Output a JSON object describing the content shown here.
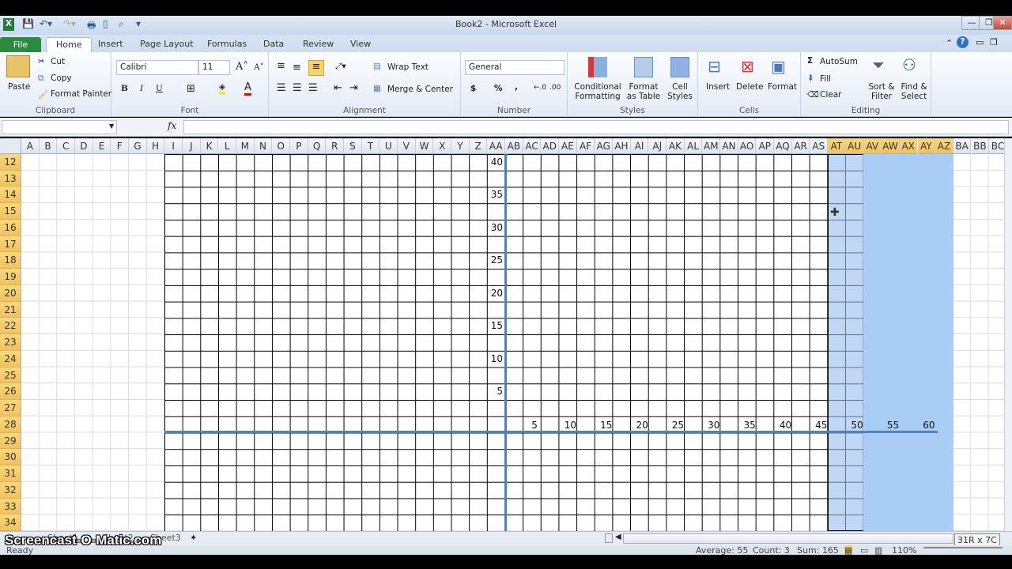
{
  "window": {
    "title": "Book2 - Microsoft Excel",
    "minimize": "—",
    "restore": "❐",
    "close": "✕"
  },
  "tabs": [
    "File",
    "Home",
    "Insert",
    "Page Layout",
    "Formulas",
    "Data",
    "Review",
    "View"
  ],
  "ribbon": {
    "clipboard": {
      "label": "Clipboard",
      "paste": "Paste",
      "cut": "Cut",
      "copy": "Copy",
      "format_painter": "Format Painter"
    },
    "font": {
      "label": "Font",
      "name": "Calibri",
      "size": "11",
      "bold": "B",
      "italic": "I",
      "underline": "U"
    },
    "alignment": {
      "label": "Alignment",
      "wrap": "Wrap Text",
      "merge": "Merge & Center"
    },
    "number": {
      "label": "Number",
      "format": "General",
      "currency": "$",
      "percent": "%",
      "comma": ","
    },
    "styles": {
      "label": "Styles",
      "conditional": "Conditional Formatting",
      "format_table": "Format as Table",
      "cell_styles": "Cell Styles"
    },
    "cells": {
      "label": "Cells",
      "insert": "Insert",
      "delete": "Delete",
      "format": "Format"
    },
    "editing": {
      "label": "Editing",
      "autosum": "AutoSum",
      "fill": "Fill",
      "clear": "Clear",
      "sort": "Sort & Filter",
      "find": "Find & Select"
    }
  },
  "formula_bar": {
    "name_box": "",
    "fx": "fx",
    "value": ""
  },
  "columns": [
    "A",
    "B",
    "C",
    "D",
    "E",
    "F",
    "G",
    "H",
    "I",
    "J",
    "K",
    "L",
    "M",
    "N",
    "O",
    "P",
    "Q",
    "R",
    "S",
    "T",
    "U",
    "V",
    "W",
    "X",
    "Y",
    "Z",
    "AA",
    "AB",
    "AC",
    "AD",
    "AE",
    "AF",
    "AG",
    "AH",
    "AI",
    "AJ",
    "AK",
    "AL",
    "AM",
    "AN",
    "AO",
    "AP",
    "AQ",
    "AR",
    "AS",
    "AT",
    "AU",
    "AV",
    "AW",
    "AX",
    "AY",
    "AZ",
    "BA",
    "BB",
    "BC"
  ],
  "selected_columns": [
    "AT",
    "AU",
    "AV",
    "AW",
    "AX",
    "AY",
    "AZ"
  ],
  "rows": [
    "12",
    "13",
    "14",
    "15",
    "16",
    "17",
    "18",
    "19",
    "20",
    "21",
    "22",
    "23",
    "24",
    "25",
    "26",
    "27",
    "28",
    "29",
    "30",
    "31",
    "32",
    "33",
    "34"
  ],
  "y_axis_labels": [
    "40",
    "35",
    "30",
    "25",
    "20",
    "15",
    "10",
    "5"
  ],
  "x_axis_labels": [
    "5",
    "10",
    "15",
    "20",
    "25",
    "30",
    "35",
    "40",
    "45",
    "50",
    "55",
    "60"
  ],
  "axis_color": "#4f81bd",
  "selection_tooltip": "31R x 7C",
  "sheets": [
    "Sheet1",
    "Sheet2",
    "Sheet3"
  ],
  "watermark": "Screencast-O-Matic.com",
  "status": {
    "mode": "Ready",
    "average": "Average: 55",
    "count": "Count: 3",
    "sum": "Sum: 165",
    "zoom": "110%"
  }
}
